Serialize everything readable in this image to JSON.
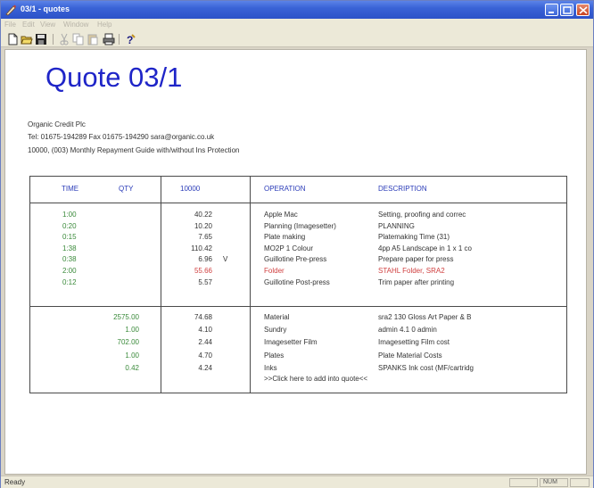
{
  "window": {
    "title": "03/1 - quotes"
  },
  "menubar": {
    "items": [
      "File",
      "Edit",
      "View",
      "Window",
      "Help"
    ]
  },
  "toolbar": {
    "buttons": [
      "new-icon",
      "open-icon",
      "save-icon",
      "cut-icon",
      "copy-icon",
      "paste-icon",
      "print-icon",
      "help-icon"
    ]
  },
  "document": {
    "title": "Quote 03/1",
    "company": "Organic Credit Plc",
    "contact": "Tel: 01675-194289 Fax 01675-194290 sara@organic.co.uk",
    "description": "10000, (003) Monthly Repayment Guide with/without Ins Protection"
  },
  "table": {
    "headers": {
      "time": "TIME",
      "qty": "QTY",
      "amount": "10000",
      "operation": "OPERATION",
      "description": "DESCRIPTION"
    },
    "operations": [
      {
        "time": "1:00",
        "amount": "40.22",
        "flag": "",
        "operation": "Apple Mac",
        "description": "Setting, proofing and correc",
        "highlight": false
      },
      {
        "time": "0:20",
        "amount": "10.20",
        "flag": "",
        "operation": "Planning (Imagesetter)",
        "description": "PLANNING",
        "highlight": false
      },
      {
        "time": "0:15",
        "amount": "7.65",
        "flag": "",
        "operation": "Plate making",
        "description": "Platemaking Time (31)",
        "highlight": false
      },
      {
        "time": "1:38",
        "amount": "110.42",
        "flag": "",
        "operation": "MO2P 1 Colour",
        "description": "4pp A5 Landscape in 1 x 1 co",
        "highlight": false
      },
      {
        "time": "0:38",
        "amount": "6.96",
        "flag": "V",
        "operation": "Guillotine Pre-press",
        "description": "Prepare paper for press",
        "highlight": false
      },
      {
        "time": "2:00",
        "amount": "55.66",
        "flag": "",
        "operation": "Folder",
        "description": "STAHL Folder, SRA2",
        "highlight": true
      },
      {
        "time": "0:12",
        "amount": "5.57",
        "flag": "",
        "operation": "Guillotine Post-press",
        "description": "Trim paper after printing",
        "highlight": false
      }
    ],
    "materials": [
      {
        "qty": "2575.00",
        "amount": "74.68",
        "operation": "Material",
        "description": "sra2 130 Gloss Art Paper & B"
      },
      {
        "qty": "1.00",
        "amount": "4.10",
        "operation": "Sundry",
        "description": "admin 4.1 0 admin"
      },
      {
        "qty": "702.00",
        "amount": "2.44",
        "operation": "Imagesetter Film",
        "description": "Imagesetting Film cost"
      },
      {
        "qty": "1.00",
        "amount": "4.70",
        "operation": "Plates",
        "description": "Plate Material Costs"
      },
      {
        "qty": "0.42",
        "amount": "4.24",
        "operation": "Inks",
        "description": "SPANKS Ink cost (MF/cartridg"
      }
    ],
    "add_link": ">>Click here to add into quote<<"
  },
  "statusbar": {
    "status": "Ready",
    "num": "NUM"
  },
  "colors": {
    "title_blue": "#1f25c8",
    "header_blue": "#2a3bb8",
    "time_green": "#3a8a3a",
    "highlight_red": "#d04040"
  }
}
